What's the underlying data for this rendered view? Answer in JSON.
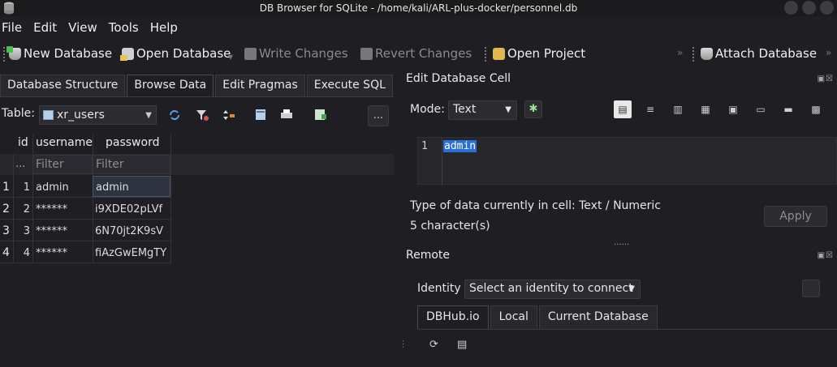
{
  "window": {
    "title": "DB Browser for SQLite - /home/kali/ARL-plus-docker/personnel.db"
  },
  "menu": [
    "File",
    "Edit",
    "View",
    "Tools",
    "Help"
  ],
  "toolbar": {
    "new_db": "New Database",
    "open_db": "Open Database",
    "write": "Write Changes",
    "revert": "Revert Changes",
    "open_project": "Open Project",
    "attach": "Attach Database"
  },
  "tabs": [
    "Database Structure",
    "Browse Data",
    "Edit Pragmas",
    "Execute SQL"
  ],
  "active_tab": "Browse Data",
  "browse": {
    "table_label": "Table:",
    "table_name": "xr_users",
    "more": "...",
    "columns": [
      "id",
      "username",
      "password"
    ],
    "filter_ellipsis": "...",
    "filter_placeholder": "Filter",
    "rows": [
      {
        "num": "1",
        "id": "1",
        "username": "admin",
        "password": "admin"
      },
      {
        "num": "2",
        "id": "2",
        "username": "******",
        "password": "i9XDE02pLVf"
      },
      {
        "num": "3",
        "id": "3",
        "username": "******",
        "password": "6N70jt2K9sV"
      },
      {
        "num": "4",
        "id": "4",
        "username": "******",
        "password": "fiAzGwEMgTY"
      }
    ]
  },
  "edit_cell": {
    "title": "Edit Database Cell",
    "mode_label": "Mode:",
    "mode_value": "Text",
    "line_number": "1",
    "content": "admin",
    "type_info": "Type of data currently in cell: Text / Numeric",
    "chars_info": "5 character(s)",
    "apply": "Apply",
    "splitter": "......"
  },
  "remote": {
    "title": "Remote",
    "identity_label": "Identity",
    "identity_value": "Select an identity to connect",
    "tabs": [
      "DBHub.io",
      "Local",
      "Current Database"
    ]
  },
  "colors": {
    "selection": "#2a6fd6",
    "background": "#1f1f23"
  }
}
